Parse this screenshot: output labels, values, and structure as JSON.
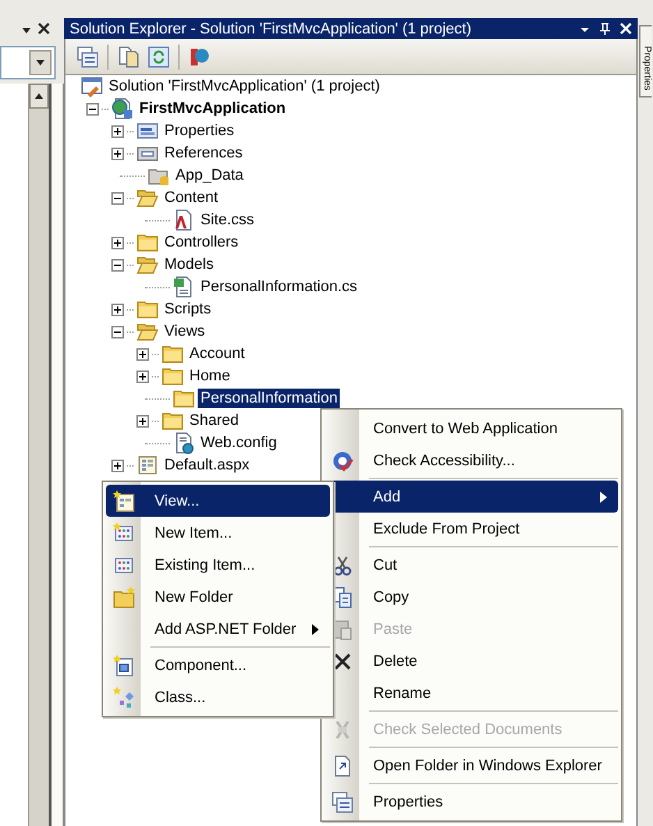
{
  "solution_explorer": {
    "title": "Solution Explorer - Solution 'FirstMvcApplication' (1 project)",
    "tree": [
      {
        "label": "Solution 'FirstMvcApplication' (1 project)",
        "kind": "solution",
        "has_expander": false,
        "selected": false,
        "children": [
          {
            "label": "FirstMvcApplication",
            "kind": "project",
            "has_expander": true,
            "expanded": true,
            "selected": false,
            "children": [
              {
                "label": "Properties",
                "kind": "properties",
                "has_expander": true,
                "expanded": false,
                "selected": false
              },
              {
                "label": "References",
                "kind": "references",
                "has_expander": true,
                "expanded": false,
                "selected": false
              },
              {
                "label": "App_Data",
                "kind": "data_folder",
                "has_expander": false,
                "selected": false
              },
              {
                "label": "Content",
                "kind": "folder",
                "has_expander": true,
                "expanded": true,
                "selected": false,
                "children": [
                  {
                    "label": "Site.css",
                    "kind": "css",
                    "has_expander": false,
                    "selected": false
                  }
                ]
              },
              {
                "label": "Controllers",
                "kind": "folder",
                "has_expander": true,
                "expanded": false,
                "selected": false
              },
              {
                "label": "Models",
                "kind": "folder",
                "has_expander": true,
                "expanded": true,
                "selected": false,
                "children": [
                  {
                    "label": "PersonalInformation.cs",
                    "kind": "cs",
                    "has_expander": false,
                    "selected": false
                  }
                ]
              },
              {
                "label": "Scripts",
                "kind": "folder",
                "has_expander": true,
                "expanded": false,
                "selected": false
              },
              {
                "label": "Views",
                "kind": "folder",
                "has_expander": true,
                "expanded": true,
                "selected": false,
                "children": [
                  {
                    "label": "Account",
                    "kind": "folder",
                    "has_expander": true,
                    "expanded": false,
                    "selected": false
                  },
                  {
                    "label": "Home",
                    "kind": "folder",
                    "has_expander": true,
                    "expanded": false,
                    "selected": false
                  },
                  {
                    "label": "PersonalInformation",
                    "kind": "folder",
                    "has_expander": false,
                    "selected": true
                  },
                  {
                    "label": "Shared",
                    "kind": "folder",
                    "has_expander": true,
                    "expanded": false,
                    "selected": false
                  },
                  {
                    "label": "Web.config",
                    "kind": "config",
                    "has_expander": false,
                    "selected": false
                  }
                ]
              },
              {
                "label": "Default.aspx",
                "kind": "aspx",
                "has_expander": true,
                "expanded": false,
                "selected": false
              }
            ]
          }
        ]
      }
    ]
  },
  "side_tab": {
    "label": "Properties"
  },
  "context_menu": {
    "items": [
      {
        "kind": "item",
        "label": "Convert to Web Application",
        "selected": false,
        "disabled": false,
        "has_submenu": false
      },
      {
        "kind": "item",
        "label": "Check Accessibility...",
        "selected": false,
        "disabled": false,
        "has_submenu": false
      },
      {
        "kind": "separator"
      },
      {
        "kind": "item",
        "label": "Add",
        "selected": true,
        "disabled": false,
        "has_submenu": true
      },
      {
        "kind": "item",
        "label": "Exclude From Project",
        "selected": false,
        "disabled": false,
        "has_submenu": false
      },
      {
        "kind": "separator"
      },
      {
        "kind": "item",
        "label": "Cut",
        "selected": false,
        "disabled": false,
        "has_submenu": false
      },
      {
        "kind": "item",
        "label": "Copy",
        "selected": false,
        "disabled": false,
        "has_submenu": false
      },
      {
        "kind": "item",
        "label": "Paste",
        "selected": false,
        "disabled": true,
        "has_submenu": false
      },
      {
        "kind": "item",
        "label": "Delete",
        "selected": false,
        "disabled": false,
        "has_submenu": false
      },
      {
        "kind": "item",
        "label": "Rename",
        "selected": false,
        "disabled": false,
        "has_submenu": false
      },
      {
        "kind": "separator"
      },
      {
        "kind": "item",
        "label": "Check Selected Documents",
        "selected": false,
        "disabled": true,
        "has_submenu": false
      },
      {
        "kind": "separator"
      },
      {
        "kind": "item",
        "label": "Open Folder in Windows Explorer",
        "selected": false,
        "disabled": false,
        "has_submenu": false
      },
      {
        "kind": "separator"
      },
      {
        "kind": "item",
        "label": "Properties",
        "selected": false,
        "disabled": false,
        "has_submenu": false
      }
    ]
  },
  "submenu": {
    "items": [
      {
        "kind": "item",
        "label": "View...",
        "selected": true,
        "disabled": false,
        "has_submenu": false
      },
      {
        "kind": "item",
        "label": "New Item...",
        "selected": false,
        "disabled": false,
        "has_submenu": false
      },
      {
        "kind": "item",
        "label": "Existing Item...",
        "selected": false,
        "disabled": false,
        "has_submenu": false
      },
      {
        "kind": "item",
        "label": "New Folder",
        "selected": false,
        "disabled": false,
        "has_submenu": false
      },
      {
        "kind": "item",
        "label": "Add ASP.NET Folder",
        "selected": false,
        "disabled": false,
        "has_submenu": true
      },
      {
        "kind": "separator"
      },
      {
        "kind": "item",
        "label": "Component...",
        "selected": false,
        "disabled": false,
        "has_submenu": false
      },
      {
        "kind": "item",
        "label": "Class...",
        "selected": false,
        "disabled": false,
        "has_submenu": false
      }
    ]
  }
}
